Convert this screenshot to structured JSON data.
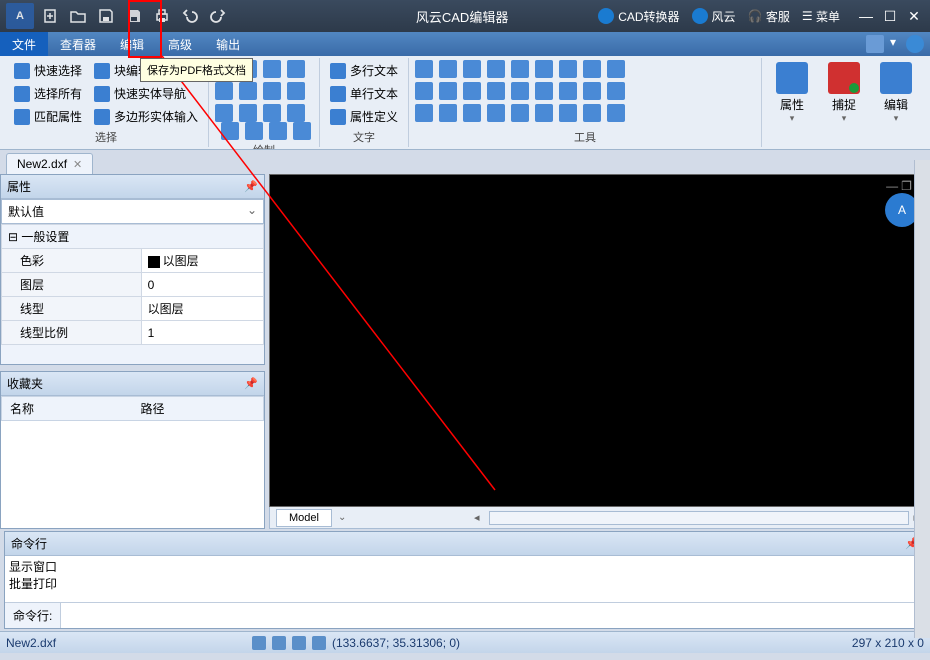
{
  "titlebar": {
    "app_logo": "A",
    "app_title": "风云CAD编辑器",
    "converter": "CAD转换器",
    "fengyun": "风云",
    "customer_service": "客服",
    "menu": "菜单"
  },
  "menubar": {
    "tabs": [
      "文件",
      "查看器",
      "编辑",
      "高级",
      "输出"
    ],
    "active_index": 0
  },
  "ribbon": {
    "sel_quick": "快速选择",
    "sel_all": "选择所有",
    "sel_match": "匹配属性",
    "sel_block": "块编辑器",
    "sel_quick_entity": "快速实体导航",
    "sel_poly": "多边形实体输入",
    "group_select": "选择",
    "group_draw": "绘制",
    "text_multi": "多行文本",
    "text_single": "单行文本",
    "text_attr": "属性定义",
    "group_text": "文字",
    "group_tool": "工具",
    "large_props": "属性",
    "large_capture": "捕捉",
    "large_edit": "编辑"
  },
  "filetabs": {
    "files": [
      "New2.dxf"
    ]
  },
  "panels": {
    "properties_title": "属性",
    "default_value": "默认值",
    "group_general": "一般设置",
    "color_label": "色彩",
    "color_value": "以图层",
    "layer_label": "图层",
    "layer_value": "0",
    "linetype_label": "线型",
    "linetype_value": "以图层",
    "ltscale_label": "线型比例",
    "ltscale_value": "1",
    "favorites_title": "收藏夹",
    "fav_col_name": "名称",
    "fav_col_path": "路径"
  },
  "canvas": {
    "ab_icon": "A",
    "model_tab": "Model"
  },
  "cmdline": {
    "title": "命令行",
    "history": [
      "显示窗口",
      "批量打印"
    ],
    "prompt": "命令行:"
  },
  "statusbar": {
    "filename": "New2.dxf",
    "coords": "(133.6637; 35.31306; 0)",
    "dims": "297 x 210 x 0"
  },
  "tooltip": "保存为PDF格式文档"
}
